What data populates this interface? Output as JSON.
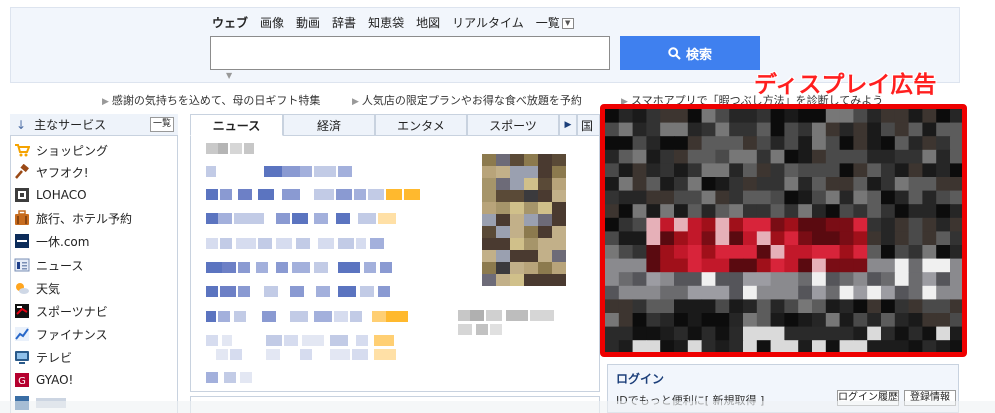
{
  "search": {
    "tabs": [
      "ウェブ",
      "画像",
      "動画",
      "辞書",
      "知恵袋",
      "地図",
      "リアルタイム"
    ],
    "more_label": "一覧",
    "button_label": "検索",
    "input_value": ""
  },
  "promos": [
    "感謝の気持ちを込めて、母の日ギフト特集",
    "人気店の限定プランやお得な食べ放題を予約",
    "スマホアプリで「暇つぶし方法」を診断してみよう"
  ],
  "sidebar": {
    "title": "主なサービス",
    "all_label": "一覧",
    "items": [
      {
        "label": "ショッピング",
        "icon": "cart-icon"
      },
      {
        "label": "ヤフオク!",
        "icon": "auction-hammer-icon"
      },
      {
        "label": "LOHACO",
        "icon": "lohaco-icon"
      },
      {
        "label": "旅行、ホテル予約",
        "icon": "suitcase-icon"
      },
      {
        "label": "一休.com",
        "icon": "ikyu-icon"
      },
      {
        "label": "ニュース",
        "icon": "news-icon"
      },
      {
        "label": "天気",
        "icon": "weather-icon"
      },
      {
        "label": "スポーツナビ",
        "icon": "sportsnavi-icon"
      },
      {
        "label": "ファイナンス",
        "icon": "finance-chart-icon"
      },
      {
        "label": "テレビ",
        "icon": "tv-icon"
      },
      {
        "label": "GYAO!",
        "icon": "gyao-icon"
      }
    ]
  },
  "news": {
    "tabs": [
      "ニュース",
      "経済",
      "エンタメ",
      "スポーツ"
    ],
    "tab_next_label": "▶",
    "tab_cut_label": "国"
  },
  "ad": {
    "label": "ディスプレイ広告"
  },
  "login": {
    "title": "ログイン",
    "text": "IDでもっと便利に[ 新規取得 ]",
    "history_label": "ログイン履歴",
    "info_label": "登録情報"
  },
  "colors": {
    "accent": "#3f80ef",
    "ad_border": "#ee0000",
    "ad_label": "#ff1f1f",
    "panel_bg": "#f2f6fc",
    "border": "#c8d2df",
    "news_blue": "#5b74c0",
    "news_orange": "#ffb92e"
  }
}
